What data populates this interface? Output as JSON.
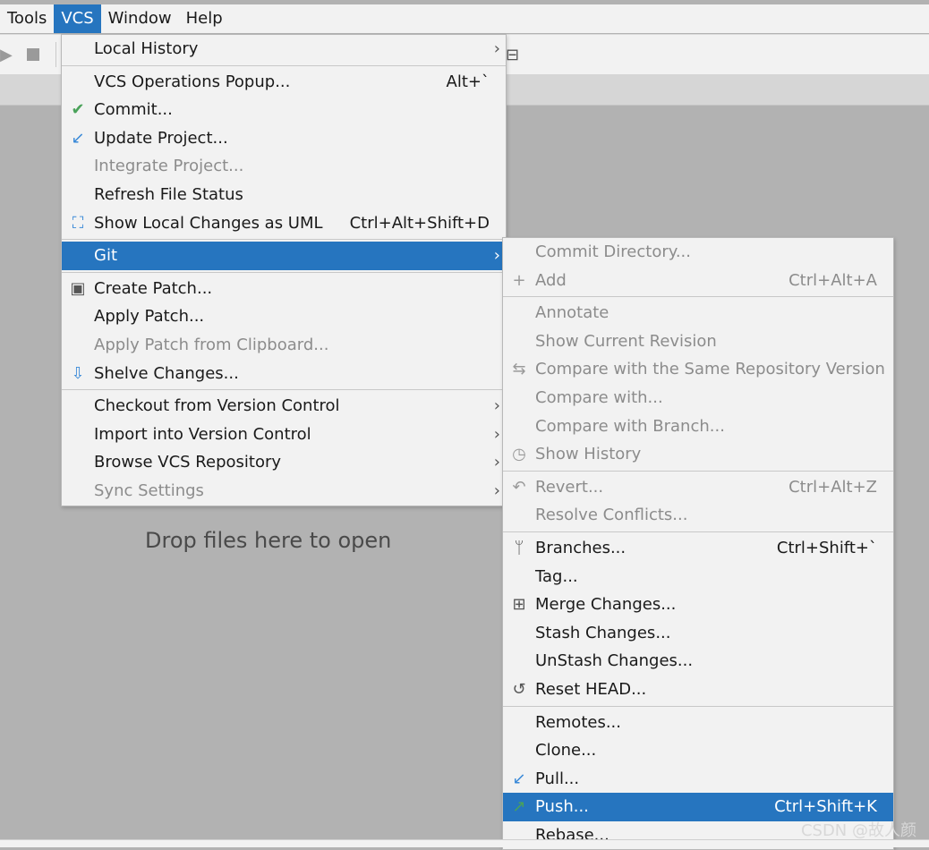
{
  "menubar": {
    "items": [
      {
        "label": "Tools",
        "active": false
      },
      {
        "label": "VCS",
        "active": true
      },
      {
        "label": "Window",
        "active": false
      },
      {
        "label": "Help",
        "active": false
      }
    ]
  },
  "workspace": {
    "drop_hint": "Drop files here to open"
  },
  "vcs_menu": {
    "groups": [
      [
        {
          "label": "Local History",
          "submenu": true
        }
      ],
      [
        {
          "label": "VCS Operations Popup...",
          "shortcut": "Alt+`"
        },
        {
          "label": "Commit...",
          "icon": "checkmark-icon"
        },
        {
          "label": "Update Project...",
          "icon": "update-arrow-icon"
        },
        {
          "label": "Integrate Project...",
          "disabled": true
        },
        {
          "label": "Refresh File Status"
        },
        {
          "label": "Show Local Changes as UML",
          "shortcut": "Ctrl+Alt+Shift+D",
          "icon": "uml-diagram-icon"
        }
      ],
      [
        {
          "label": "Git",
          "submenu": true,
          "selected": true
        }
      ],
      [
        {
          "label": "Create Patch...",
          "icon": "patch-file-icon"
        },
        {
          "label": "Apply Patch..."
        },
        {
          "label": "Apply Patch from Clipboard...",
          "disabled": true
        },
        {
          "label": "Shelve Changes...",
          "icon": "shelve-icon"
        }
      ],
      [
        {
          "label": "Checkout from Version Control",
          "submenu": true
        },
        {
          "label": "Import into Version Control",
          "submenu": true
        },
        {
          "label": "Browse VCS Repository",
          "submenu": true
        },
        {
          "label": "Sync Settings",
          "submenu": true,
          "disabled": true
        }
      ]
    ]
  },
  "git_menu": {
    "groups": [
      [
        {
          "label": "Commit Directory...",
          "disabled": true
        },
        {
          "label": "Add",
          "shortcut": "Ctrl+Alt+A",
          "icon": "plus-icon",
          "disabled": true
        }
      ],
      [
        {
          "label": "Annotate",
          "disabled": true
        },
        {
          "label": "Show Current Revision",
          "disabled": true
        },
        {
          "label": "Compare with the Same Repository Version",
          "icon": "compare-arrows-icon",
          "disabled": true
        },
        {
          "label": "Compare with...",
          "disabled": true
        },
        {
          "label": "Compare with Branch...",
          "disabled": true
        },
        {
          "label": "Show History",
          "icon": "clock-icon",
          "disabled": true
        }
      ],
      [
        {
          "label": "Revert...",
          "shortcut": "Ctrl+Alt+Z",
          "icon": "revert-icon",
          "disabled": true
        },
        {
          "label": "Resolve Conflicts...",
          "disabled": true
        }
      ],
      [
        {
          "label": "Branches...",
          "shortcut": "Ctrl+Shift+`",
          "icon": "branch-icon"
        },
        {
          "label": "Tag..."
        },
        {
          "label": "Merge Changes...",
          "icon": "merge-icon"
        },
        {
          "label": "Stash Changes..."
        },
        {
          "label": "UnStash Changes..."
        },
        {
          "label": "Reset HEAD...",
          "icon": "reset-icon"
        }
      ],
      [
        {
          "label": "Remotes..."
        },
        {
          "label": "Clone..."
        },
        {
          "label": "Pull...",
          "icon": "pull-arrow-icon"
        },
        {
          "label": "Push...",
          "shortcut": "Ctrl+Shift+K",
          "icon": "push-arrow-icon",
          "selected": true
        },
        {
          "label": "Rebase..."
        }
      ]
    ]
  },
  "watermark": "CSDN @故人颜",
  "icons": {
    "checkmark-icon": "✔",
    "update-arrow-icon": "↙",
    "uml-diagram-icon": "⛶",
    "patch-file-icon": "▣",
    "shelve-icon": "⇩",
    "plus-icon": "+",
    "compare-arrows-icon": "⇆",
    "clock-icon": "◷",
    "revert-icon": "↶",
    "branch-icon": "ᛘ",
    "merge-icon": "⊞",
    "reset-icon": "↺",
    "pull-arrow-icon": "↙",
    "push-arrow-icon": "↗"
  },
  "colors": {
    "selection": "#2675bf",
    "menu_bg": "#f2f2f2",
    "workspace_bg": "#b2b2b2",
    "disabled_text": "#8c8c8c"
  }
}
